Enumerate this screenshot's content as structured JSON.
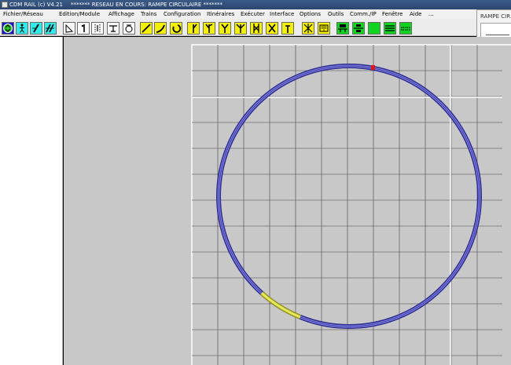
{
  "window": {
    "app_title": "CDM RAIL (c) V4.21",
    "document_title": "******* RESEAU EN COURS: RAMPE CIRCULAIRE *******"
  },
  "menu": [
    "Fichier/Réseau",
    "Edition/Module",
    "Affichage",
    "Trains",
    "Configuration",
    "Itinéraires",
    "Exécuter",
    "Interface",
    "Options",
    "Outils",
    "Comm./IP",
    "Fenêtre",
    "Aide",
    "..."
  ],
  "toolbar": {
    "tools": [
      {
        "icon": "select-mode-icon",
        "color": "blue"
      },
      {
        "icon": "figure-icon",
        "color": "cyan"
      },
      {
        "icon": "slash-icon",
        "color": "cyan"
      },
      {
        "icon": "double-slash-icon",
        "color": "cyan"
      },
      {
        "icon": "signal-icon",
        "color": "white"
      },
      {
        "icon": "pole-icon",
        "color": "white"
      },
      {
        "icon": "dotted-pole-icon",
        "color": "white"
      },
      {
        "icon": "buffer-stop-icon",
        "color": "white"
      },
      {
        "icon": "turntable-icon",
        "color": "white"
      },
      {
        "icon": "straight-track-icon",
        "color": "yellow"
      },
      {
        "icon": "curve-track-icon",
        "color": "yellow"
      },
      {
        "icon": "loop-track-icon",
        "color": "yellow"
      },
      {
        "icon": "turnout-left-icon",
        "color": "yellow"
      },
      {
        "icon": "turnout-right-icon",
        "color": "yellow"
      },
      {
        "icon": "y-turnout-icon",
        "color": "yellow"
      },
      {
        "icon": "three-way-turnout-icon",
        "color": "yellow"
      },
      {
        "icon": "double-slip-icon",
        "color": "yellow"
      },
      {
        "icon": "crossing-icon",
        "color": "yellow"
      },
      {
        "icon": "bumper-icon",
        "color": "yellow"
      },
      {
        "icon": "diamond-crossing-icon",
        "color": "yellow"
      },
      {
        "icon": "book-icon",
        "color": "yellow"
      },
      {
        "icon": "module-insert-icon",
        "color": "green"
      },
      {
        "icon": "module-split-icon",
        "color": "green"
      },
      {
        "icon": "green-block-icon",
        "color": "green"
      },
      {
        "icon": "parallel-tracks-icon",
        "color": "green"
      },
      {
        "icon": "dashed-tracks-icon",
        "color": "green"
      }
    ]
  },
  "floating_panel": {
    "title": "RAMPE CIR"
  },
  "colors": {
    "track_main": "#3838b0",
    "track_highlight": "#d8d848",
    "grid_line": "#333333",
    "canvas_bg": "#c8c8c8",
    "marker": "#e01818"
  }
}
